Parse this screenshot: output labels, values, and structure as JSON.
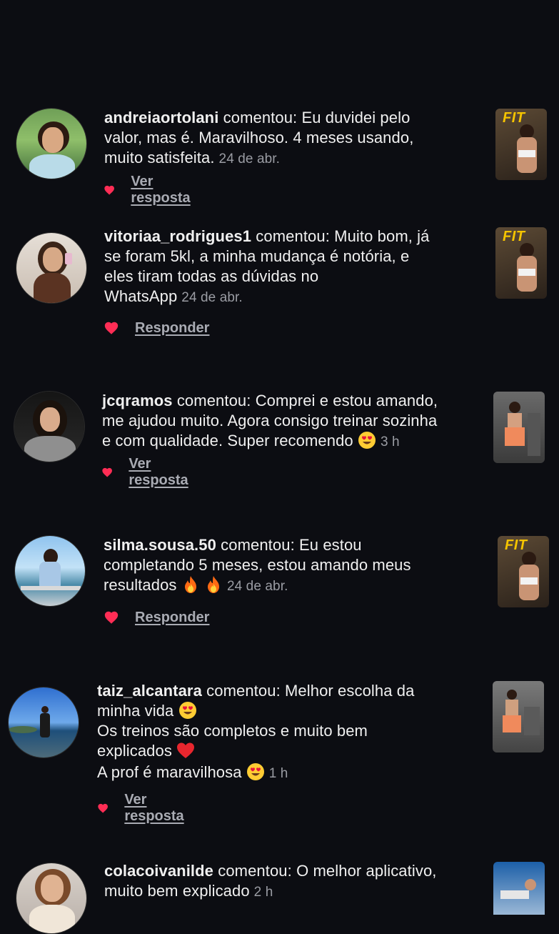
{
  "colors": {
    "background": "#0c0d12",
    "heart": "#ff2d55",
    "link": "#a9abb3",
    "timestamp": "#9a9ca3",
    "fit_label": "#f5c400"
  },
  "comments": [
    {
      "username": "andreiaortolani",
      "verb": " comentou: ",
      "lines": [
        "Eu duvidei pelo",
        "valor, mas é. Maravilhoso.  4 meses usando,",
        "muito satisfeita."
      ],
      "time": "24 de abr.",
      "action": "Ver resposta",
      "thumb_label": "FIT"
    },
    {
      "username": "vitoriaa_rodrigues1",
      "verb": " comentou: ",
      "lines": [
        "Muito bom, já",
        "se foram 5kl, a minha mudança é notória, e",
        "eles tiram todas as dúvidas no",
        "WhatsApp"
      ],
      "time": "24 de abr.",
      "action": "Responder",
      "thumb_label": "FIT"
    },
    {
      "username": "jcqramos",
      "verb": " comentou: ",
      "lines": [
        "Comprei e estou amando,",
        "me ajudou muito. Agora consigo treinar sozinha",
        "e com qualidade. Super recomendo"
      ],
      "time": "3 h",
      "action": "Ver resposta"
    },
    {
      "username": "silma.sousa.50",
      "verb": " comentou: ",
      "lines": [
        "Eu estou",
        "completando 5 meses, estou amando meus",
        "resultados"
      ],
      "time": "24 de abr.",
      "action": "Responder",
      "thumb_label": "FIT"
    },
    {
      "username": "taiz_alcantara",
      "verb": " comentou: ",
      "lines": [
        "Melhor escolha da",
        "minha vida",
        "Os treinos são completos e muito bem",
        "explicados",
        "A prof é maravilhosa"
      ],
      "time": "1 h",
      "action": "Ver resposta"
    },
    {
      "username": "colacoivanilde",
      "verb": " comentou: ",
      "lines": [
        "O melhor aplicativo,",
        "muito bem explicado"
      ],
      "time": "2 h"
    }
  ]
}
